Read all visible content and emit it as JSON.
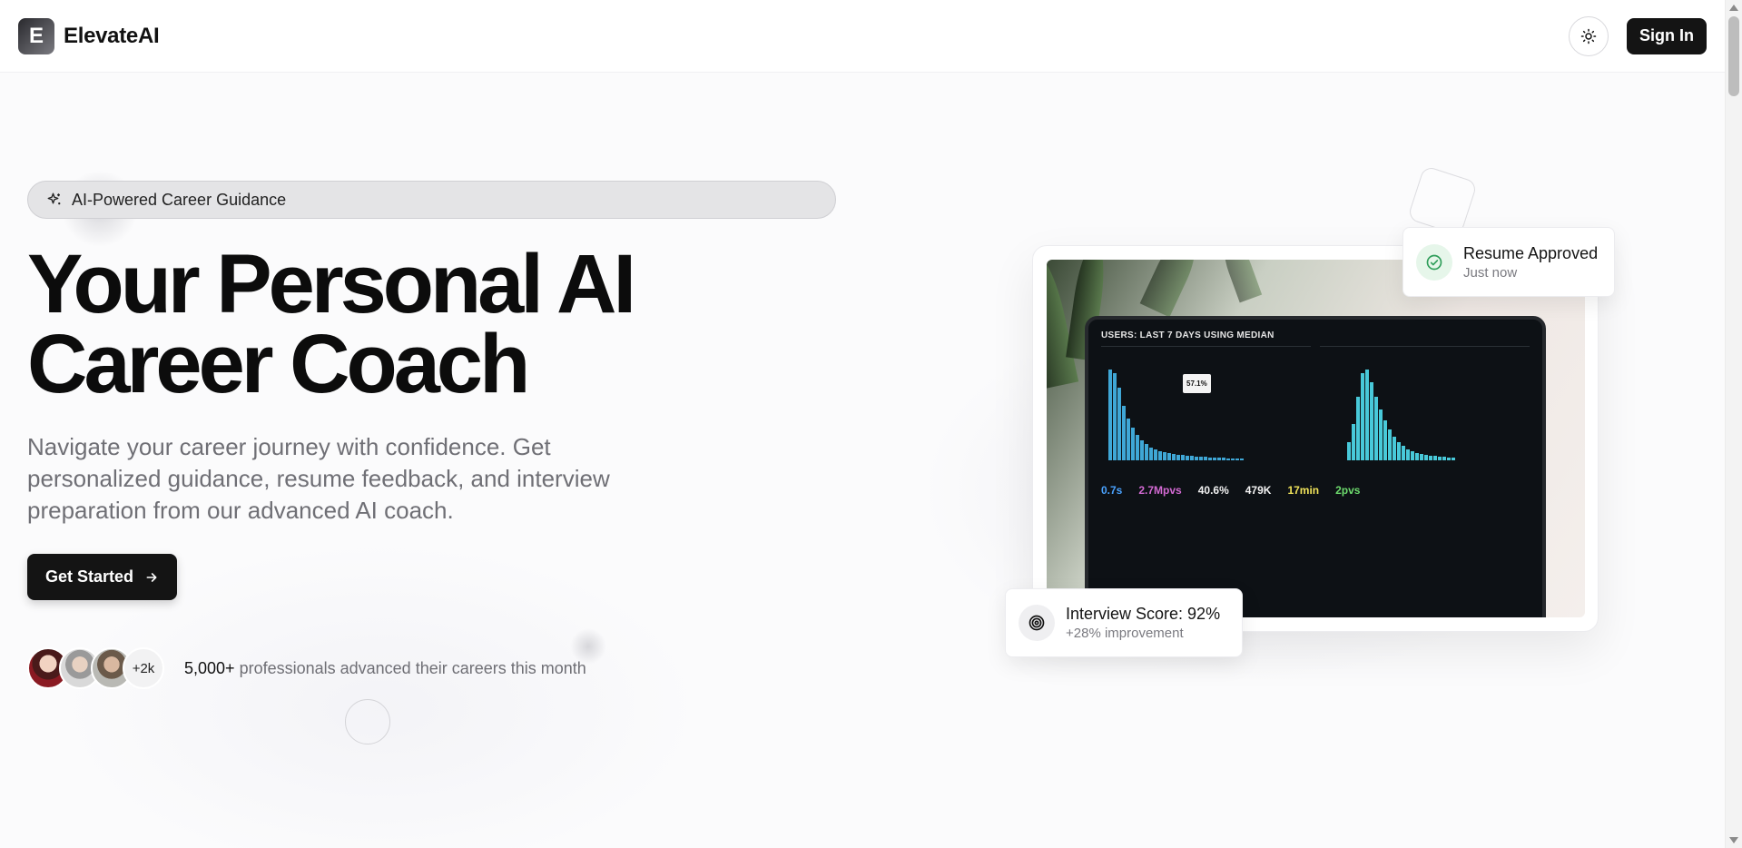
{
  "header": {
    "logo_letter": "E",
    "brand_name": "ElevateAI",
    "theme_toggle_icon": "sun-icon",
    "signin_label": "Sign In"
  },
  "hero": {
    "badge_icon": "sparkles-icon",
    "badge_text": "AI-Powered Career Guidance",
    "headline_line1": "Your Personal AI",
    "headline_line2": "Career Coach",
    "subtext": "Navigate your career journey with confidence. Get personalized guidance, resume feedback, and interview preparation from our advanced AI coach.",
    "cta_label": "Get Started",
    "cta_icon": "arrow-right-icon",
    "avatars_more": "+2k",
    "proof_count": "5,000+",
    "proof_text": " professionals advanced their careers this month"
  },
  "cards": {
    "resume": {
      "title": "Resume Approved",
      "subtitle": "Just now",
      "icon": "check-circle-icon"
    },
    "interview": {
      "title": "Interview Score: 92%",
      "subtitle": "+28% improvement",
      "icon": "target-icon"
    }
  },
  "dashboard": {
    "title": "USERS: LAST 7 DAYS USING MEDIAN",
    "tooltip": "57.1%",
    "metrics": [
      "0.7s",
      "2.7Mpvs",
      "40.6%",
      "479K",
      "17min",
      "2pvs"
    ]
  },
  "colors": {
    "primary": "#141414",
    "accent_green": "#2f9e5a",
    "muted_text": "#6f6f75"
  }
}
